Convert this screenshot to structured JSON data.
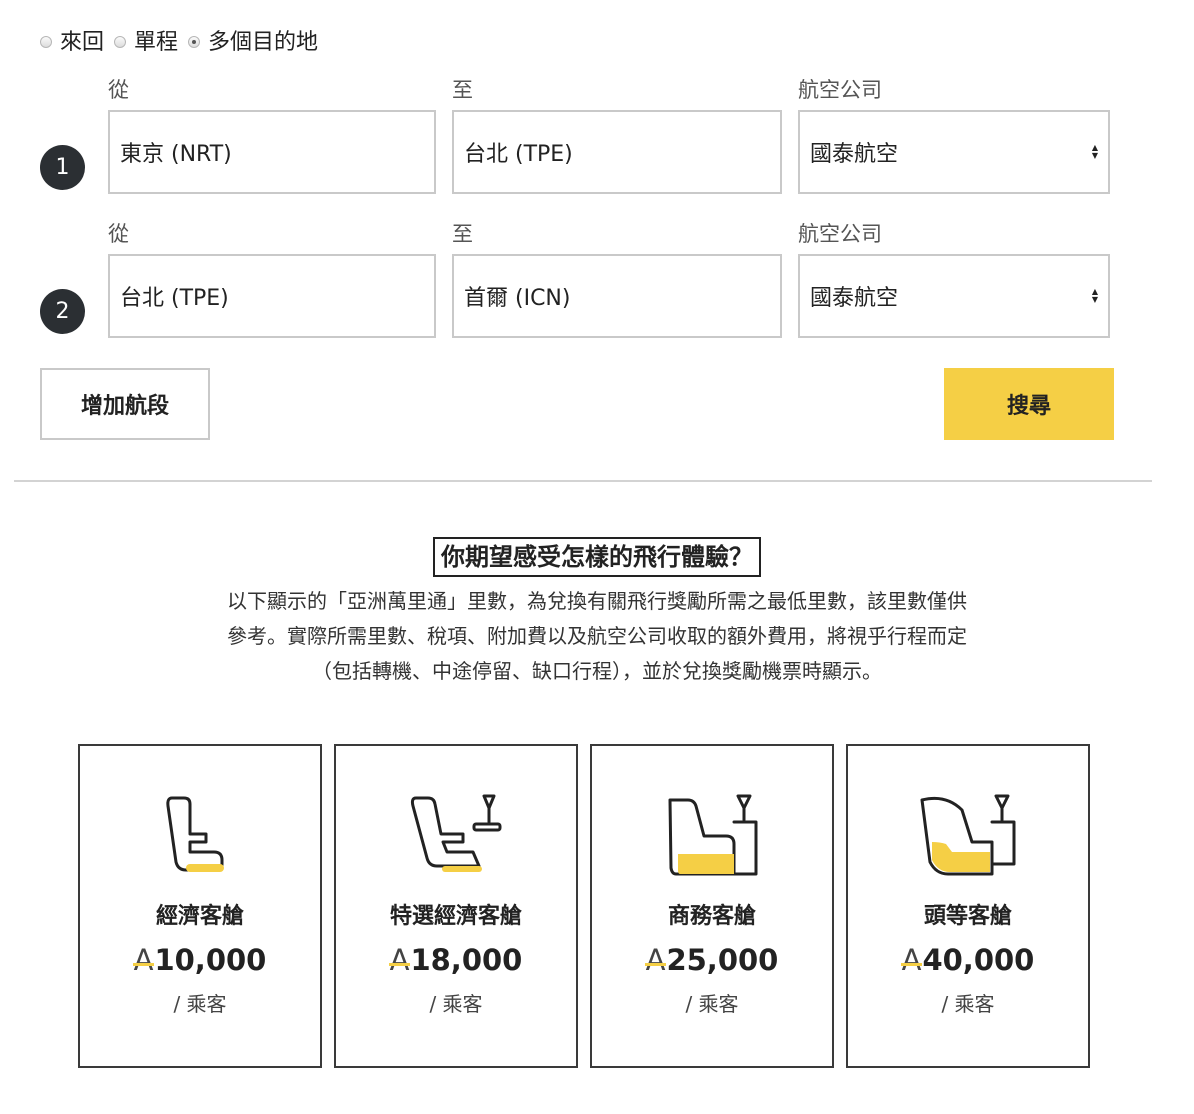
{
  "trip_types": [
    {
      "label": "來回",
      "checked": false
    },
    {
      "label": "單程",
      "checked": false
    },
    {
      "label": "多個目的地",
      "checked": true
    }
  ],
  "labels": {
    "from": "從",
    "to": "至",
    "airline": "航空公司"
  },
  "legs": [
    {
      "number": "1",
      "from": "東京 (NRT)",
      "to": "台北 (TPE)",
      "airline": "國泰航空"
    },
    {
      "number": "2",
      "from": "台北 (TPE)",
      "to": "首爾 (ICN)",
      "airline": "國泰航空"
    }
  ],
  "buttons": {
    "add_leg": "增加航段",
    "search": "搜尋"
  },
  "experience": {
    "title": "你期望感受怎樣的飛行體驗？",
    "description_lines": [
      "以下顯示的「亞洲萬里通」里數，為兌換有關飛行獎勵所需之最低里數，該里數僅供",
      "參考。實際所需里數、稅項、附加費以及航空公司收取的額外費用，將視乎行程而定",
      "（包括轉機、中途停留、缺口行程），並於兌換獎勵機票時顯示。"
    ]
  },
  "miles_symbol": "A",
  "cabins": [
    {
      "name": "經濟客艙",
      "miles": "10,000",
      "unit": "/ 乘客",
      "icon": "economy-seat-icon"
    },
    {
      "name": "特選經濟客艙",
      "miles": "18,000",
      "unit": "/ 乘客",
      "icon": "premium-economy-seat-icon"
    },
    {
      "name": "商務客艙",
      "miles": "25,000",
      "unit": "/ 乘客",
      "icon": "business-seat-icon"
    },
    {
      "name": "頭等客艙",
      "miles": "40,000",
      "unit": "/ 乘客",
      "icon": "first-class-seat-icon"
    }
  ],
  "colors": {
    "accent": "#f5cf45",
    "badge": "#2b2f33",
    "border": "#c9c9c9"
  }
}
